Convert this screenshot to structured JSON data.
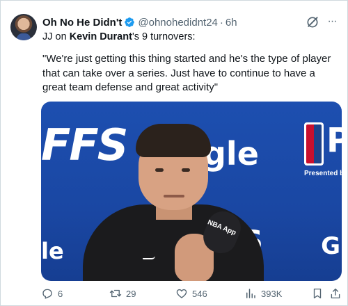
{
  "tweet": {
    "author_name": "Oh No He Didn't",
    "handle": "@ohnohedidnt24",
    "separator": "·",
    "time": "6h",
    "more_label": "···",
    "subline_prefix": "JJ on ",
    "subline_name": "Kevin Durant",
    "subline_suffix": "'s 9 turnovers:",
    "quote": "\"We're just getting this thing started and he's the type of player that can take over a series. Just have to continue to have a great team defense and great activity\""
  },
  "media": {
    "backdrop_ffs": "FFS",
    "backdrop_gle": "gle",
    "backdrop_le": "le",
    "backdrop_g": "G",
    "backdrop_s": "S",
    "backdrop_p": "P",
    "nba_text": "NBA",
    "presented_by": "Presented by",
    "mic_label": "NBA App"
  },
  "actions": {
    "replies": "6",
    "reposts": "29",
    "likes": "546",
    "views": "393K"
  },
  "colors": {
    "text_primary": "#0f1419",
    "text_secondary": "#536471",
    "verified_blue": "#1d9bf0",
    "backdrop_blue": "#1d4fb0"
  },
  "icons": {
    "verified": "verified-badge-icon",
    "grok": "grok-icon",
    "reply": "reply-icon",
    "repost": "repost-icon",
    "like": "heart-icon",
    "views": "views-chart-icon",
    "bookmark": "bookmark-icon",
    "share": "share-icon"
  }
}
